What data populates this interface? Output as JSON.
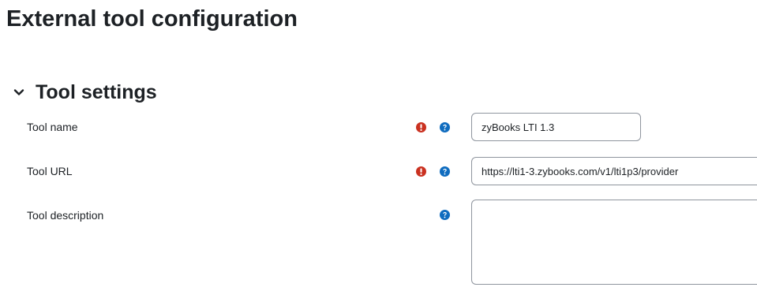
{
  "page": {
    "title": "External tool configuration"
  },
  "section": {
    "title": "Tool settings",
    "expanded": true
  },
  "fields": {
    "tool_name": {
      "label": "Tool name",
      "value": "zyBooks LTI 1.3",
      "required": true,
      "help_icon": "question-circle-icon",
      "required_icon": "exclamation-circle-icon"
    },
    "tool_url": {
      "label": "Tool URL",
      "value": "https://lti1-3.zybooks.com/v1/lti1p3/provider",
      "required": true,
      "help_icon": "question-circle-icon",
      "required_icon": "exclamation-circle-icon"
    },
    "tool_description": {
      "label": "Tool description",
      "value": "",
      "required": false,
      "help_icon": "question-circle-icon"
    }
  },
  "colors": {
    "required_icon": "#ca3120",
    "help_icon": "#0f6cbf",
    "input_border": "#8f959e",
    "text": "#1d2125"
  }
}
